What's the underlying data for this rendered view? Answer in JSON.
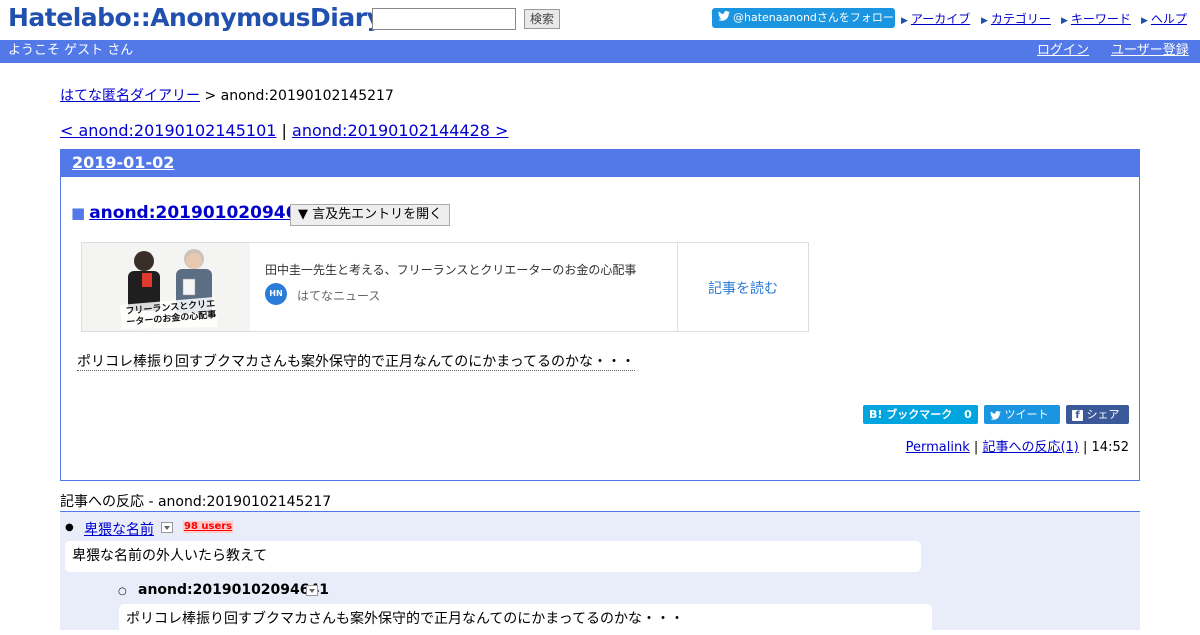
{
  "header": {
    "logo": "Hatelabo::AnonymousDiary",
    "search_placeholder": "",
    "search_button": "検索",
    "follow_button": "@hatenaanondさんをフォロー",
    "nav": [
      "アーカイブ",
      "カテゴリー",
      "キーワード",
      "ヘルプ"
    ]
  },
  "userbar": {
    "welcome": "ようこそ ゲスト さん",
    "login": "ログイン",
    "register": "ユーザー登録"
  },
  "breadcrumb": {
    "home": "はてな匿名ダイアリー",
    "separator": ">",
    "current": "anond:20190102145217"
  },
  "pager": {
    "prev": "< anond:20190102145101",
    "separator": "|",
    "next": "anond:20190102144428 >"
  },
  "day": {
    "date": "2019-01-02",
    "entry": {
      "marker": "■",
      "title": "anond:20190102094641",
      "toggle": "▼ 言及先エントリを開く"
    },
    "news_card": {
      "headline": "田中圭一先生と考える、フリーランスとクリエーターのお金の心配事",
      "source": "はてなニュース",
      "source_badge": "HN",
      "read_more": "記事を読む",
      "thumb_caption": "フリーランスとクリエーターのお金の心配事"
    },
    "body": "ポリコレ棒振り回すブクマカさんも案外保守的で正月なんてのにかまってるのかな・・・",
    "share": {
      "bookmark": "B! ブックマーク",
      "bookmark_count": "0",
      "tweet": "ツイート",
      "facebook": "シェア"
    },
    "footer": {
      "permalink": "Permalink",
      "reactions": "記事への反応(1)",
      "time": "14:52",
      "sep": "|"
    }
  },
  "reactions": {
    "title": "記事への反応 - anond:20190102145217",
    "items": [
      {
        "title": "卑猥な名前",
        "users": "98 users",
        "text": "卑猥な名前の外人いたら教えて"
      }
    ],
    "nested": {
      "title": "anond:20190102094641",
      "text": "ポリコレ棒振り回すブクマカさんも案外保守的で正月なんてのにかまってるのかな・・・"
    }
  },
  "colors": {
    "brand_blue": "#5279e7",
    "logo_blue": "#2150ae",
    "twitter": "#1b95e0",
    "hatena_bookmark": "#00a4de",
    "facebook": "#3b5998",
    "link": "#0000cc"
  }
}
